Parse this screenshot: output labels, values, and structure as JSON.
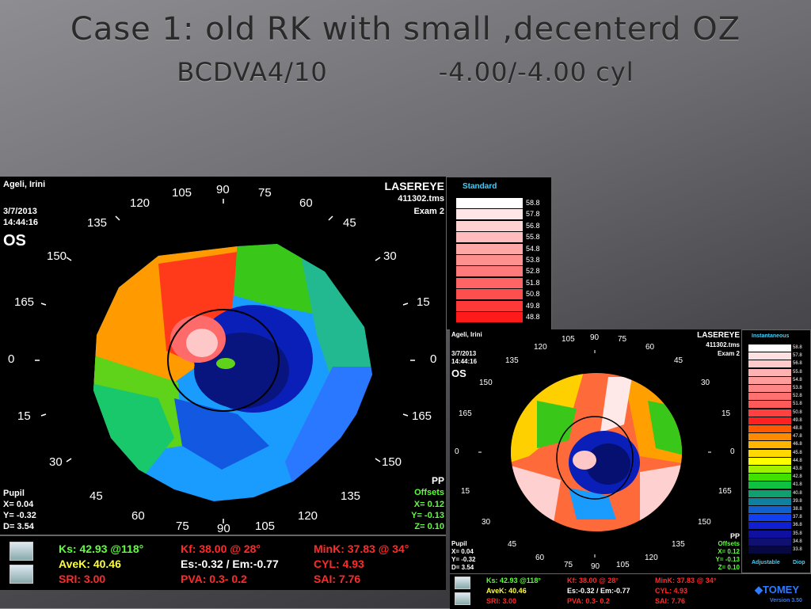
{
  "slide": {
    "title": "Case 1: old RK with small ,decenterd OZ",
    "subtitle_left": "BCDVA4/10",
    "subtitle_right": "-4.00/-4.00 cyl"
  },
  "map1": {
    "patient": "Ageli, Irini",
    "date": "3/7/2013",
    "time": "14:44:16",
    "eye": "OS",
    "clinic": "LASEREYE",
    "file": "411302.tms",
    "exam": "Exam 2",
    "pupil_label": "Pupil",
    "pupil_x": "X=  0.04",
    "pupil_y": "Y= -0.32",
    "pupil_d": "D=  3.54",
    "pp": "PP",
    "offsets": "Offsets",
    "off_x": "X=  0.12",
    "off_y": "Y= -0.13",
    "off_z": "Z=  0.10",
    "legend_title": "Standard",
    "legend_values": [
      "58.8",
      "57.8",
      "56.8",
      "55.8",
      "54.8",
      "53.8",
      "52.8",
      "51.8",
      "50.8",
      "49.8",
      "48.8"
    ]
  },
  "map2": {
    "patient": "Ageli, Irini",
    "date": "3/7/2013",
    "time": "14:44:16",
    "eye": "OS",
    "clinic": "LASEREYE",
    "file": "411302.tms",
    "exam": "Exam 2",
    "pupil_label": "Pupil",
    "pupil_x": "X=  0.04",
    "pupil_y": "Y= -0.32",
    "pupil_d": "D=  3.54",
    "pp": "PP",
    "offsets": "Offsets",
    "off_x": "X=  0.12",
    "off_y": "Y= -0.13",
    "off_z": "Z=  0.10",
    "legend_title": "Instantaneous",
    "legend_values": [
      "58.8",
      "57.8",
      "56.8",
      "55.8",
      "54.8",
      "53.8",
      "52.8",
      "51.8",
      "50.8",
      "49.8",
      "48.8",
      "47.8",
      "46.8",
      "45.8",
      "44.8",
      "43.8",
      "42.8",
      "41.8",
      "40.8",
      "39.8",
      "38.8",
      "37.8",
      "36.8",
      "35.8",
      "34.8",
      "33.8"
    ],
    "adjustable": "Adjustable",
    "diop": "Diop",
    "brand": "TOMEY",
    "version": "Version 3.50"
  },
  "axis_labels": {
    "top": [
      "90",
      "105",
      "75",
      "120",
      "60",
      "135",
      "45",
      "150",
      "30",
      "165",
      "15",
      "0",
      "0",
      "15",
      "165",
      "30",
      "150",
      "45",
      "135",
      "60",
      "120",
      "75",
      "105",
      "90"
    ]
  },
  "stats": {
    "ks": "Ks: 42.93 @118°",
    "kf": "Kf: 38.00 @ 28°",
    "mink": "MinK: 37.83 @ 34°",
    "avek": "AveK: 40.46",
    "es": "Es:-0.32 / Em:-0.77",
    "cyl": "CYL:  4.93",
    "sri": "SRI: 3.00",
    "pva": "PVA:   0.3-  0.2",
    "sai": "SAI: 7.76"
  },
  "colors": {
    "green": "#5dff3a",
    "yellow": "#ffff40",
    "red": "#ff2a2a",
    "white": "#ffffff",
    "legend_title": "#3fd0ff"
  },
  "icons": [
    "printer-icon",
    "export-icon"
  ]
}
